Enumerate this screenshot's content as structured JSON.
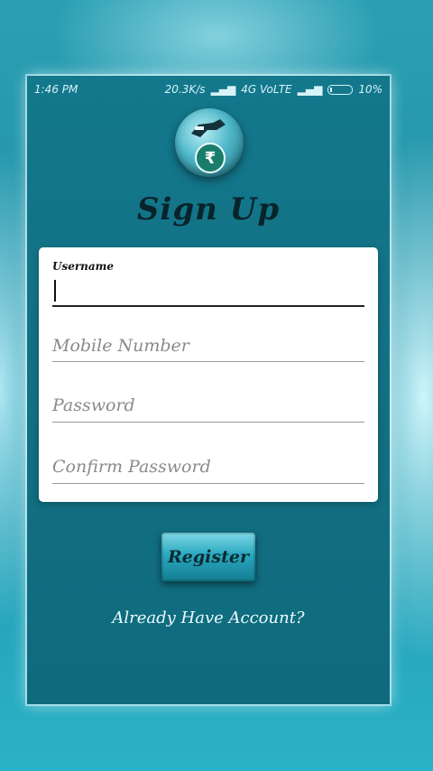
{
  "status_bar": {
    "time": "1:46 PM",
    "network_speed": "20.3K/s",
    "network_type": "4G VoLTE",
    "battery": "10%"
  },
  "header": {
    "logo_icon": "hand-holding-rupee-icon",
    "title": "Sign Up"
  },
  "form": {
    "username": {
      "label": "Username",
      "value": ""
    },
    "mobile": {
      "placeholder": "Mobile Number"
    },
    "password": {
      "placeholder": "Password"
    },
    "confirm_password": {
      "placeholder": "Confirm Password"
    }
  },
  "actions": {
    "register_label": "Register",
    "already_account_label": "Already Have Account?"
  }
}
